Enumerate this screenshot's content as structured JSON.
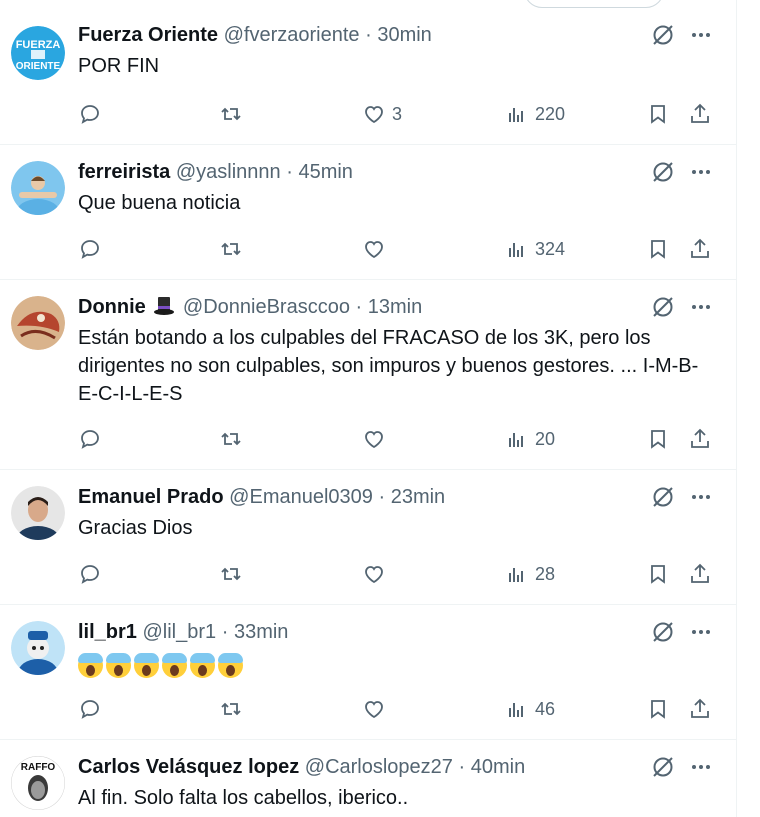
{
  "tweets": [
    {
      "name": "Fuerza Oriente",
      "handle": "@fverzaoriente",
      "sep": "·",
      "time": "30min",
      "text": "POR FIN",
      "likes": "3",
      "views": "220",
      "avatar_text_top": "FUERZA",
      "avatar_text_bottom": "ORIENTE"
    },
    {
      "name": "ferreirista",
      "handle": "@yaslinnnn",
      "sep": "·",
      "time": "45min",
      "text": "Que buena noticia",
      "likes": "",
      "views": "324"
    },
    {
      "name": "Donnie",
      "handle": "@DonnieBrasccoo",
      "sep": "·",
      "time": "13min",
      "text": "Están botando a los culpables del FRACASO de los 3K, pero los dirigentes no son culpables, son impuros y buenos gestores. ... I-M-B-E-C-I-L-E-S",
      "likes": "",
      "views": "20"
    },
    {
      "name": "Emanuel Prado",
      "handle": "@Emanuel0309",
      "sep": "·",
      "time": "23min",
      "text": "Gracias Dios",
      "likes": "",
      "views": "28"
    },
    {
      "name": "lil_br1",
      "handle": "@lil_br1",
      "sep": "·",
      "time": "33min",
      "text": "",
      "likes": "",
      "views": "46"
    },
    {
      "name": "Carlos Velásquez lopez",
      "handle": "@Carloslopez27",
      "sep": "·",
      "time": "40min",
      "text": "Al fin. Solo falta los cabellos, iberico..",
      "avatar_text_top": "RAFFO"
    }
  ],
  "icons": {
    "reply": "reply-icon",
    "retweet": "retweet-icon",
    "like": "heart-icon",
    "views": "views-icon",
    "bookmark": "bookmark-icon",
    "share": "share-icon",
    "grok": "grok-icon",
    "more": "more-icon"
  },
  "colors": {
    "text": "#0f1419",
    "secondary": "#536471",
    "divider": "#eff3f4",
    "brand_blue": "#1d9bf0"
  }
}
